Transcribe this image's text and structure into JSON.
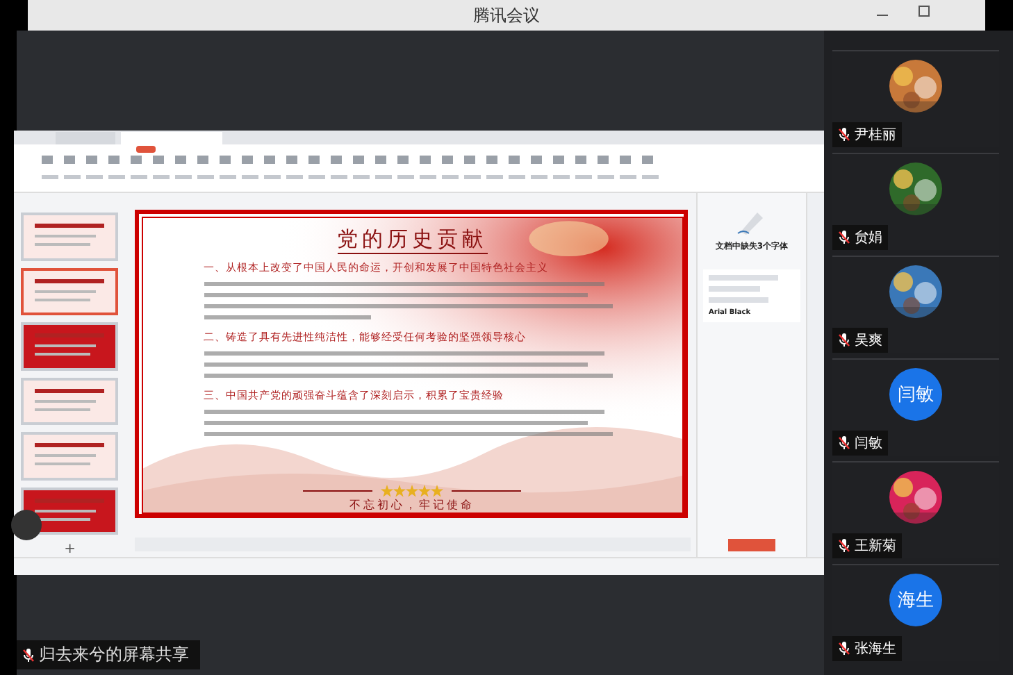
{
  "window": {
    "title": "腾讯会议"
  },
  "editor": {
    "thumbnails": [
      {
        "selected": false
      },
      {
        "selected": true
      },
      {
        "selected": false
      },
      {
        "selected": false
      },
      {
        "selected": false
      },
      {
        "selected": false
      }
    ],
    "add_slide": "+"
  },
  "slide": {
    "title": "党的历史贡献",
    "sections": [
      {
        "heading": "一、从根本上改变了中国人民的命运，开创和发展了中国特色社会主义"
      },
      {
        "heading": "二、铸造了具有先进性纯洁性，能够经受任何考验的坚强领导核心"
      },
      {
        "heading": "三、中国共产党的顽强奋斗蕴含了深刻启示，积累了宝贵经验"
      }
    ],
    "stars": 5,
    "motto": "不忘初心，牢记使命"
  },
  "font_panel": {
    "title": "文档中缺失3个字体",
    "fonts": [
      {
        "name": "Arial Black"
      }
    ]
  },
  "participants": [
    {
      "name": "尹桂丽"
    },
    {
      "name": "贠娟"
    },
    {
      "name": "吴爽"
    },
    {
      "name": "闫敏",
      "avatar": {
        "kind": "initials",
        "text": "闫敏"
      }
    },
    {
      "name": "王新菊"
    },
    {
      "name": "张海生",
      "avatar": {
        "kind": "initials",
        "text": "海生"
      }
    }
  ],
  "share_banner": "归去来兮的屏幕共享"
}
